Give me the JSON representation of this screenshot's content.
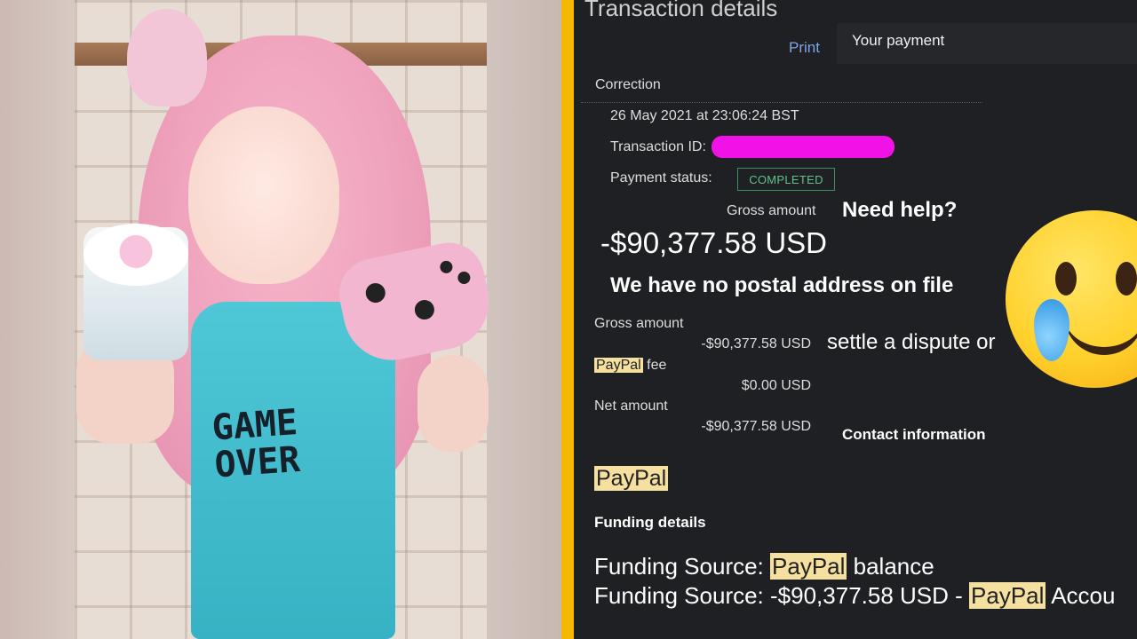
{
  "photo": {
    "shirt_text": "GAME OVER"
  },
  "transaction": {
    "title": "Transaction details",
    "print_label": "Print",
    "your_payment": "Your payment",
    "correction": "Correction",
    "date": "26 May 2021 at 23:06:24 BST",
    "transaction_id_label": "Transaction ID:",
    "payment_status_label": "Payment status:",
    "payment_status": "COMPLETED",
    "gross_amount_label": "Gross amount",
    "need_help": "Need help?",
    "gross_amount_big": "-$90,377.58 USD",
    "no_postal": "We have no postal address on file",
    "breakdown": {
      "gross_label": "Gross amount",
      "gross_value": "-$90,377.58 USD",
      "fee_brand": "PayPal",
      "fee_label": "fee",
      "fee_value": "$0.00 USD",
      "net_label": "Net amount",
      "net_value": "-$90,377.58 USD"
    },
    "settle_text": "settle a dispute or",
    "contact_info": "Contact information",
    "paypal_logo_text": "PayPal",
    "funding_details_title": "Funding details",
    "funding_line1": {
      "prefix": "Funding Source: ",
      "brand": "PayPal",
      "suffix": " balance"
    },
    "funding_line2": {
      "prefix": "Funding Source: -$90,377.58 USD - ",
      "brand": "PayPal",
      "suffix": " Accou"
    }
  },
  "colors": {
    "divider": "#f5b800",
    "panel_bg": "#1f2023",
    "link": "#7fa6e6",
    "status_green": "#5ec38a",
    "redaction": "#f112e8",
    "highlight": "#f6e0a0"
  },
  "icons": {
    "emoji": "smiling-face-with-tear-icon"
  }
}
